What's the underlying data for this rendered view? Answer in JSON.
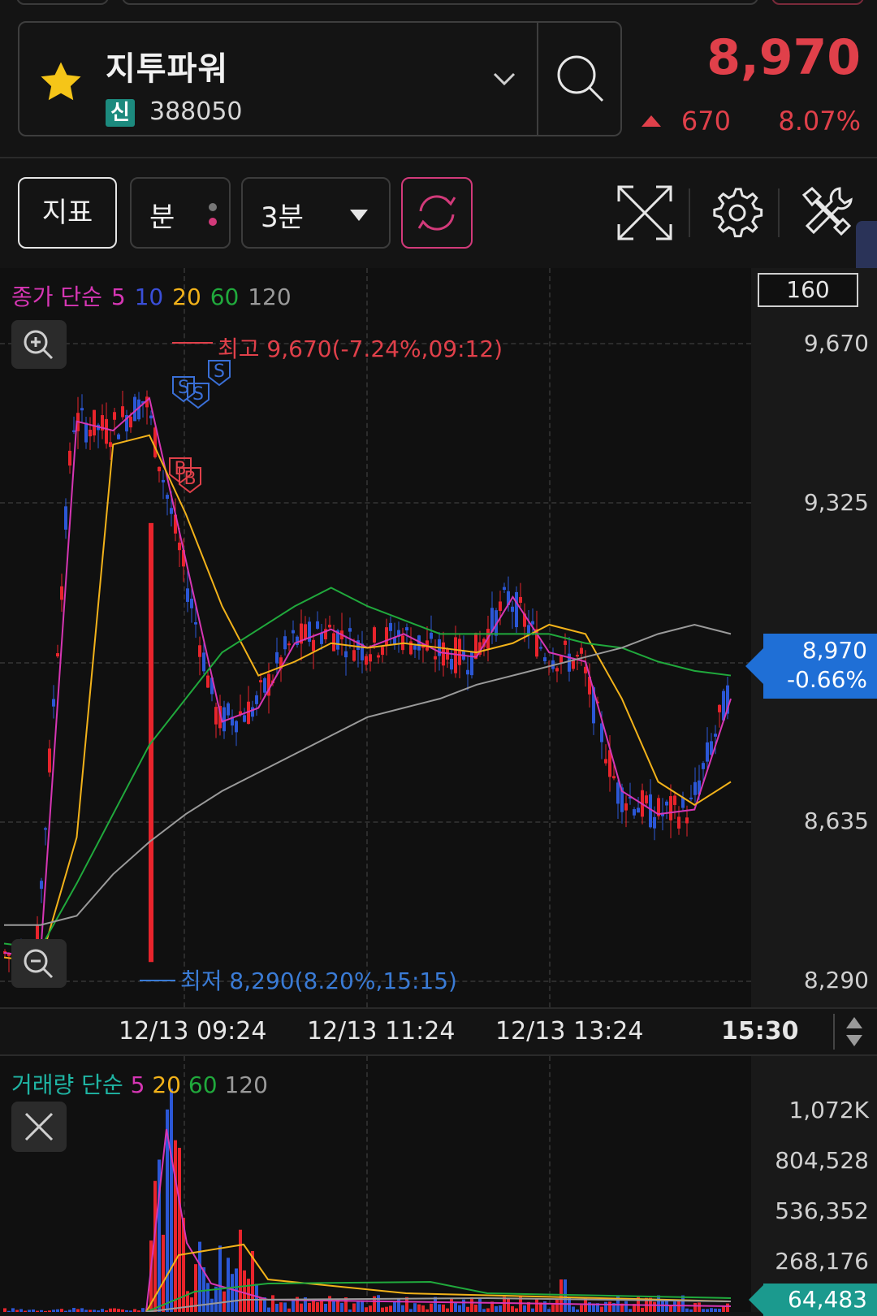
{
  "header": {
    "stock_name": "지투파워",
    "badge": "신",
    "stock_code": "388050",
    "price": "8,970",
    "change": "670",
    "change_pct": "8.07%",
    "accent_up": "#e0404a"
  },
  "toolbar": {
    "indicator_label": "지표",
    "minute_label": "분",
    "interval_label": "3분",
    "icons": [
      "refresh-icon",
      "expand-icon",
      "gear-icon",
      "tools-icon"
    ]
  },
  "main_chart": {
    "legend": {
      "prefix": "종가 단순",
      "periods": [
        "5",
        "10",
        "20",
        "60",
        "120"
      ],
      "colors": [
        "#d636b4",
        "#3a4fd8",
        "#f2b21a",
        "#20a93c",
        "#9a9a9a"
      ]
    },
    "visible_count": "160",
    "price_ticks": [
      "9,670",
      "9,325",
      "8,970",
      "8,635",
      "8,290"
    ],
    "high_label": "최고 9,670(-7.24%,09:12)",
    "low_label": "최저 8,290(8.20%,15:15)",
    "current_price": "8,970",
    "current_pct": "-0.66%",
    "time_ticks": [
      "12/13 09:24",
      "12/13 11:24",
      "12/13 13:24"
    ],
    "end_time": "15:30",
    "markers": {
      "sell": "S",
      "buy": "B"
    }
  },
  "volume_chart": {
    "legend": {
      "prefix": "거래량 단순",
      "periods": [
        "5",
        "20",
        "60",
        "120"
      ],
      "colors": [
        "#d636b4",
        "#f2b21a",
        "#20a93c",
        "#9a9a9a"
      ]
    },
    "ticks": [
      "1,072K",
      "804,528",
      "536,352",
      "268,176"
    ],
    "current_volume": "64,483"
  },
  "chart_data": {
    "type": "candlestick",
    "interval": "3분",
    "ylim": [
      8290,
      9670
    ],
    "ticks": [
      "9,670",
      "9,325",
      "8,970",
      "8,635",
      "8,290"
    ],
    "high": 9670,
    "low": 8290,
    "last": 8970,
    "x_ticks": [
      "12/13 09:24",
      "12/13 11:24",
      "12/13 13:24",
      "15:30"
    ],
    "series": [
      {
        "name": "5",
        "values": [
          8350,
          8340,
          9500,
          9480,
          9550,
          9200,
          8850,
          8880,
          9020,
          9050,
          9010,
          9040,
          9000,
          8990,
          9120,
          9000,
          8980,
          8700,
          8650,
          8660,
          8900
        ]
      },
      {
        "name": "20",
        "values": [
          8340,
          8330,
          8600,
          9450,
          9470,
          9300,
          9100,
          8950,
          8980,
          9020,
          9010,
          9020,
          9010,
          9000,
          9020,
          9060,
          9040,
          8900,
          8720,
          8670,
          8720
        ]
      },
      {
        "name": "60",
        "values": [
          8370,
          8360,
          8500,
          8650,
          8800,
          8900,
          9000,
          9050,
          9100,
          9140,
          9100,
          9070,
          9040,
          9040,
          9040,
          9040,
          9020,
          9010,
          8980,
          8960,
          8950
        ]
      },
      {
        "name": "120",
        "values": [
          8410,
          8410,
          8430,
          8520,
          8590,
          8650,
          8700,
          8740,
          8780,
          8820,
          8860,
          8880,
          8900,
          8930,
          8950,
          8970,
          8990,
          9010,
          9040,
          9060,
          9040
        ]
      }
    ]
  }
}
